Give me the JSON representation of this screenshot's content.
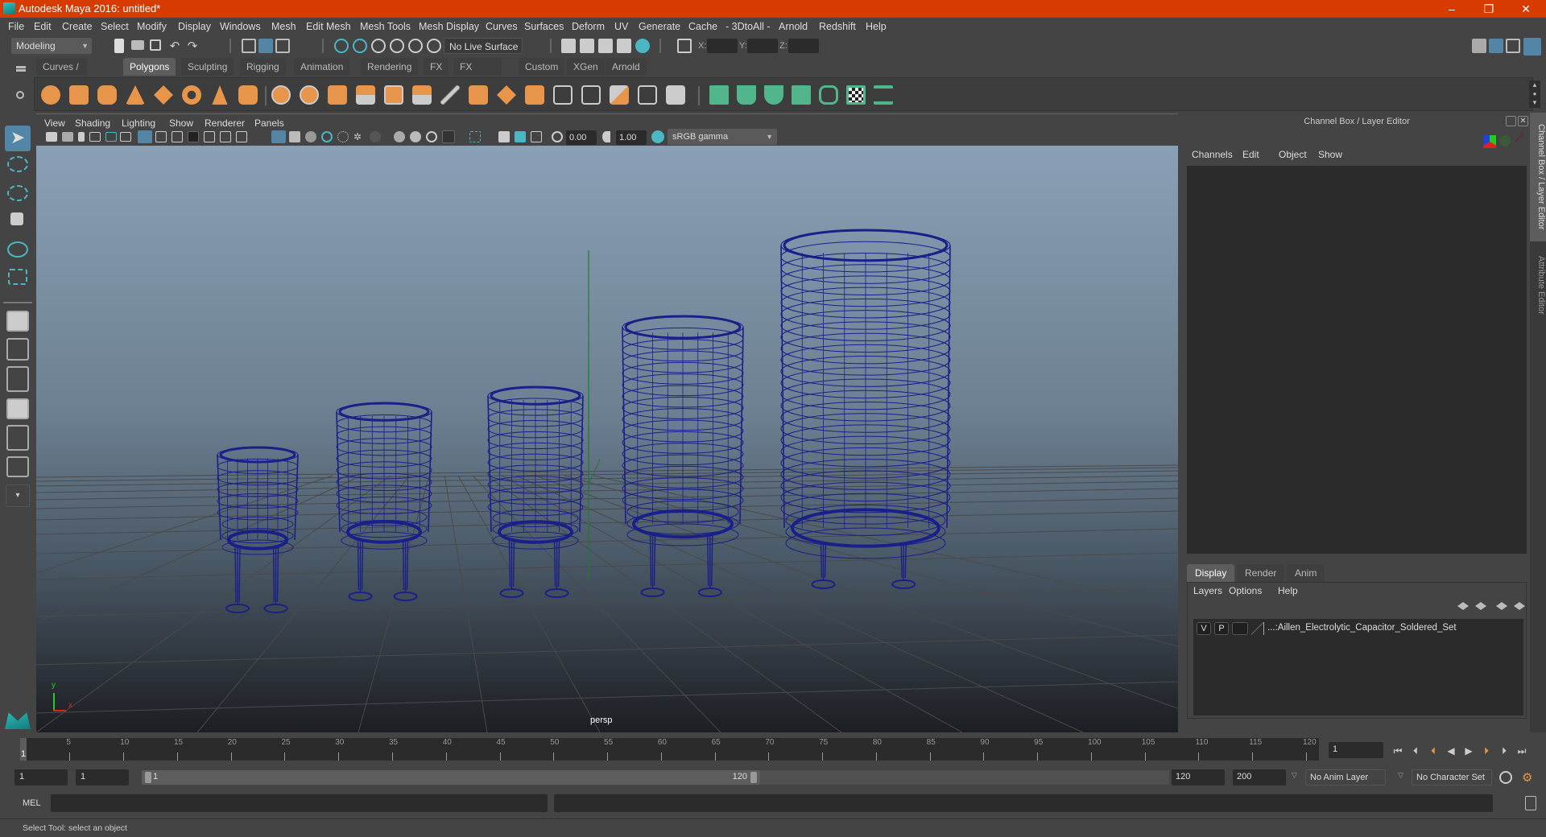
{
  "window": {
    "title": "Autodesk Maya 2016: untitled*",
    "controls": {
      "minimize": "–",
      "restore": "❐",
      "close": "✕"
    }
  },
  "menubar": [
    "File",
    "Edit",
    "Create",
    "Select",
    "Modify",
    "Display",
    "Windows",
    "Mesh",
    "Edit Mesh",
    "Mesh Tools",
    "Mesh Display",
    "Curves",
    "Surfaces",
    "Deform",
    "UV",
    "Generate",
    "Cache",
    "- 3DtoAll -",
    "Arnold",
    "Redshift",
    "Help"
  ],
  "statusline": {
    "workspace": "Modeling",
    "live_surface": "No Live Surface",
    "x_label": "X:",
    "y_label": "Y:",
    "z_label": "Z:",
    "x_value": "",
    "y_value": "",
    "z_value": ""
  },
  "shelf": {
    "tabs": [
      "Curves / Surfaces",
      "Polygons",
      "Sculpting",
      "Rigging",
      "Animation",
      "Rendering",
      "FX",
      "FX Caching",
      "Custom",
      "XGen",
      "Arnold"
    ],
    "active_tab": "Polygons",
    "poly_icons": [
      "sphere-icon",
      "cube-icon",
      "cylinder-icon",
      "cone-icon",
      "plane-icon",
      "torus-icon",
      "pyramid-icon",
      "pipe-icon",
      "combine-icon",
      "separate-icon",
      "mirror-icon",
      "smooth-icon",
      "extract-icon",
      "bevel-icon",
      "bridge-icon",
      "extrude-icon",
      "append-icon",
      "fill-hole-icon",
      "multicut-icon",
      "target-weld-icon",
      "merge-icon",
      "quadrangulate-icon",
      "boolean-icon"
    ],
    "uv_icons": [
      "planar-uv-icon",
      "cylindrical-uv-icon",
      "spherical-uv-icon",
      "automatic-uv-icon",
      "unfold-uv-icon",
      "uv-editor-icon",
      "cut-sew-uv-icon"
    ],
    "accent_poly": "#e6954a",
    "accent_uv": "#52b68c"
  },
  "panel_menu": [
    "View",
    "Shading",
    "Lighting",
    "Show",
    "Renderer",
    "Panels"
  ],
  "panel_toolbar": {
    "exposure": "0.00",
    "gamma": "1.00",
    "color_space": "sRGB gamma"
  },
  "viewport": {
    "camera_label": "persp",
    "axis_y": "y",
    "axis_x": "x",
    "wire_color": "#1a1f8a",
    "objects": [
      {
        "name": "capacitor-1",
        "size": "small"
      },
      {
        "name": "capacitor-2",
        "size": "medium-small"
      },
      {
        "name": "capacitor-3",
        "size": "medium"
      },
      {
        "name": "capacitor-4",
        "size": "medium-large"
      },
      {
        "name": "capacitor-5",
        "size": "large"
      }
    ]
  },
  "channel_box": {
    "title": "Channel Box / Layer Editor",
    "menus": [
      "Channels",
      "Edit",
      "Object",
      "Show"
    ]
  },
  "layer_editor": {
    "tabs": [
      "Display",
      "Render",
      "Anim"
    ],
    "active_tab": "Display",
    "menus": [
      "Layers",
      "Options",
      "Help"
    ],
    "layers": [
      {
        "visible": "V",
        "playback": "P",
        "name": "...:Aillen_Electrolytic_Capacitor_Soldered_Set"
      }
    ]
  },
  "side_tabs": [
    "Channel Box / Layer Editor",
    "Attribute Editor"
  ],
  "timeline": {
    "ticks": [
      "5",
      "10",
      "15",
      "20",
      "25",
      "30",
      "35",
      "40",
      "45",
      "50",
      "55",
      "60",
      "65",
      "70",
      "75",
      "80",
      "85",
      "90",
      "95",
      "100",
      "105",
      "110",
      "115",
      "120"
    ],
    "current_frame_marker": "1",
    "current_frame": "1"
  },
  "range": {
    "start": "1",
    "playback_start": "1",
    "slider_start": "1",
    "slider_end": "120",
    "playback_end": "120",
    "end": "200",
    "anim_layer": "No Anim Layer",
    "character_set": "No Character Set"
  },
  "command_line": {
    "label": "MEL",
    "value": "",
    "result": ""
  },
  "help_line": "Select Tool: select an object"
}
